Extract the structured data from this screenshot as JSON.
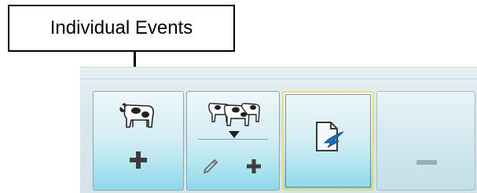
{
  "callout": {
    "label": "Individual Events"
  },
  "toolbar": {
    "buttons": [
      {
        "name": "add-individual-event",
        "icons": [
          "cow-icon",
          "plus-icon"
        ]
      },
      {
        "name": "group-events",
        "icons": [
          "cows-group-icon",
          "dropdown-arrow-icon",
          "pencil-icon",
          "plus-icon"
        ]
      },
      {
        "name": "import-document",
        "icons": [
          "import-document-icon"
        ],
        "state": "focused"
      },
      {
        "name": "remove",
        "icons": [
          "minus-icon"
        ],
        "state": "disabled"
      }
    ]
  },
  "colors": {
    "focus_border": "#e8e26a",
    "button_gradient_bottom": "#8ed8ea",
    "ribbon": "#d9e7ec"
  }
}
